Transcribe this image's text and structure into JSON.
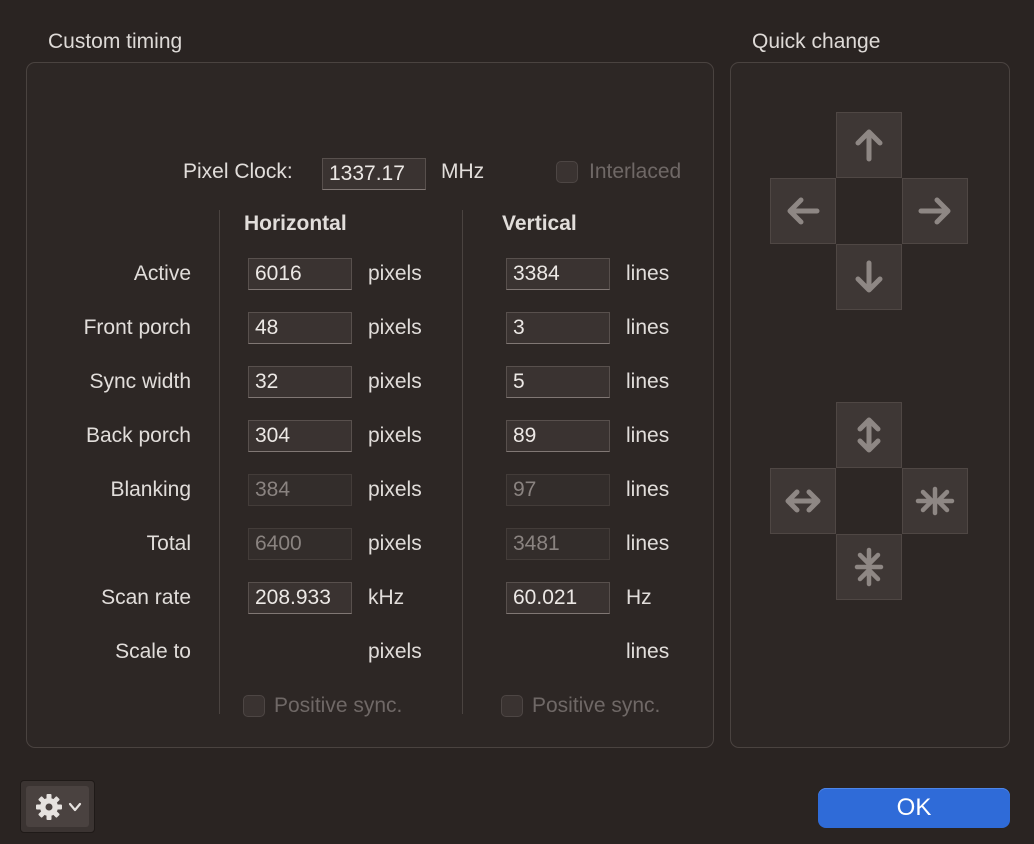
{
  "custom_timing": {
    "title": "Custom timing",
    "pixel_clock": {
      "label": "Pixel Clock:",
      "value": "1337.17",
      "unit": "MHz"
    },
    "interlaced": {
      "label": "Interlaced",
      "checked": false
    },
    "horizontal_header": "Horizontal",
    "vertical_header": "Vertical",
    "rows": [
      {
        "label": "Active",
        "h": "6016",
        "h_unit": "pixels",
        "v": "3384",
        "v_unit": "lines"
      },
      {
        "label": "Front porch",
        "h": "48",
        "h_unit": "pixels",
        "v": "3",
        "v_unit": "lines"
      },
      {
        "label": "Sync width",
        "h": "32",
        "h_unit": "pixels",
        "v": "5",
        "v_unit": "lines"
      },
      {
        "label": "Back porch",
        "h": "304",
        "h_unit": "pixels",
        "v": "89",
        "v_unit": "lines"
      },
      {
        "label": "Blanking",
        "h": "384",
        "h_unit": "pixels",
        "v": "97",
        "v_unit": "lines"
      },
      {
        "label": "Total",
        "h": "6400",
        "h_unit": "pixels",
        "v": "3481",
        "v_unit": "lines"
      },
      {
        "label": "Scan rate",
        "h": "208.933",
        "h_unit": "kHz",
        "v": "60.021",
        "v_unit": "Hz"
      },
      {
        "label": "Scale to",
        "h_unit": "pixels",
        "v_unit": "lines"
      }
    ],
    "h_positive_sync": {
      "label": "Positive sync.",
      "checked": false
    },
    "v_positive_sync": {
      "label": "Positive sync.",
      "checked": false
    }
  },
  "quick_change": {
    "title": "Quick change",
    "move_icons": [
      "arrow-up-icon",
      "arrow-left-icon",
      "arrow-right-icon",
      "arrow-down-icon"
    ],
    "resize_icons": [
      "expand-vertical-icon",
      "expand-horizontal-icon",
      "shrink-horizontal-icon",
      "shrink-vertical-icon"
    ]
  },
  "footer": {
    "gear_icon": "gear-icon",
    "ok_label": "OK"
  },
  "colors": {
    "accent": "#2f6bd8",
    "background": "#2a2422",
    "panel": "#2d2725"
  }
}
